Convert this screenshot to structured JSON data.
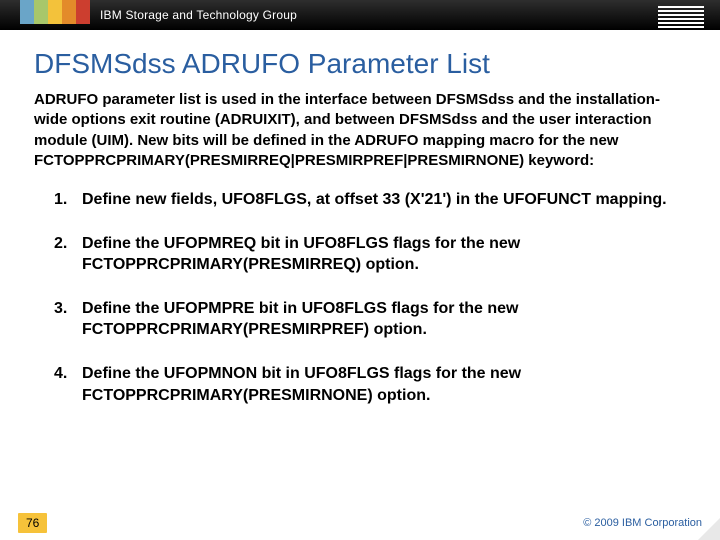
{
  "header": {
    "group": "IBM Storage and Technology Group"
  },
  "title": "DFSMSdss ADRUFO Parameter List",
  "intro": "ADRUFO parameter list is used in the interface between DFSMSdss and the installation-wide options exit routine (ADRUIXIT), and between DFSMSdss and the user interaction module (UIM). New bits will be defined in the ADRUFO mapping macro for the new FCTOPPRCPRIMARY(PRESMIRREQ|PRESMIRPREF|PRESMIRNONE) keyword:",
  "steps": [
    "Define new fields, UFO8FLGS, at offset 33 (X'21') in the UFOFUNCT mapping.",
    "Define the UFOPMREQ bit in UFO8FLGS flags for the new FCTOPPRCPRIMARY(PRESMIRREQ) option.",
    "Define the UFOPMPRE bit in UFO8FLGS flags for the new FCTOPPRCPRIMARY(PRESMIRPREF) option.",
    "Define the UFOPMNON bit in UFO8FLGS flags for the new FCTOPPRCPRIMARY(PRESMIRNONE) option."
  ],
  "footer": {
    "page": "76",
    "copyright": "© 2009 IBM Corporation"
  }
}
